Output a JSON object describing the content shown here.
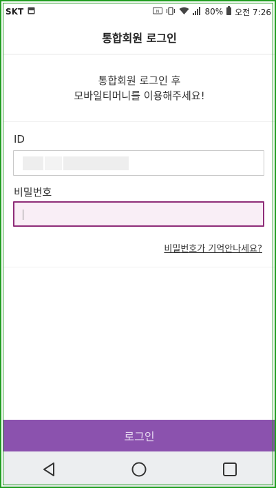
{
  "status_bar": {
    "carrier": "SKT",
    "battery_percent": "80%",
    "time": "오전 7:26"
  },
  "header": {
    "title": "통합회원 로그인"
  },
  "intro": {
    "line1": "통합회원 로그인 후",
    "line2": "모바일티머니를 이용해주세요!"
  },
  "form": {
    "id_label": "ID",
    "password_label": "비밀번호",
    "forgot_password": "비밀번호가 기억안나세요?"
  },
  "login_button": {
    "label": "로그인"
  },
  "colors": {
    "accent": "#8b52ae",
    "focus_border": "#8e2c78",
    "focus_bg": "#f9eef6"
  }
}
